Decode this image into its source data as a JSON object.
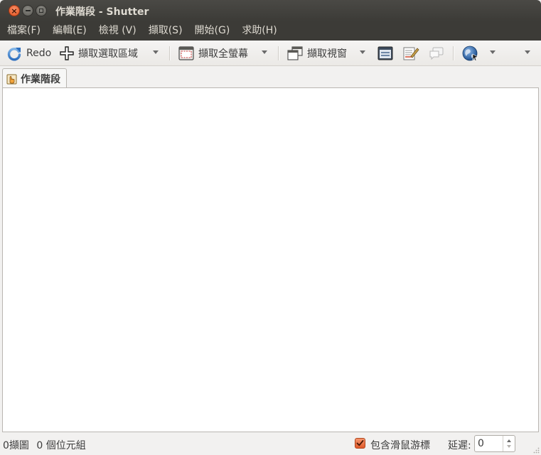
{
  "window": {
    "title": "作業階段 - Shutter"
  },
  "menubar": {
    "items": [
      "檔案(F)",
      "編輯(E)",
      "檢視 (V)",
      "擷取(S)",
      "開始(G)",
      "求助(H)"
    ]
  },
  "toolbar": {
    "redo_label": "Redo",
    "selection_label": "擷取選取區域",
    "fullscreen_label": "擷取全螢幕",
    "window_label": "擷取視窗"
  },
  "tabs": {
    "session_label": "作業階段"
  },
  "statusbar": {
    "screenshot_count": "0擷圖",
    "size_text": "0 個位元組",
    "include_cursor_label": "包含滑鼠游標",
    "include_cursor_checked": true,
    "delay_label": "延遲:",
    "delay_value": "0"
  },
  "colors": {
    "titlebar": "#3c3b37",
    "accent": "#e05a2a",
    "content_bg": "#ffffff",
    "window_bg": "#f2f1f0"
  },
  "icons": {
    "redo": "redo-arrow-icon",
    "selection": "crosshair-icon",
    "fullscreen": "fullscreen-capture-icon",
    "window": "window-capture-icon",
    "menu": "menu-capture-icon",
    "edit": "edit-icon",
    "tooltip": "tooltip-capture-icon",
    "web": "globe-icon",
    "session": "session-tab-icon"
  }
}
